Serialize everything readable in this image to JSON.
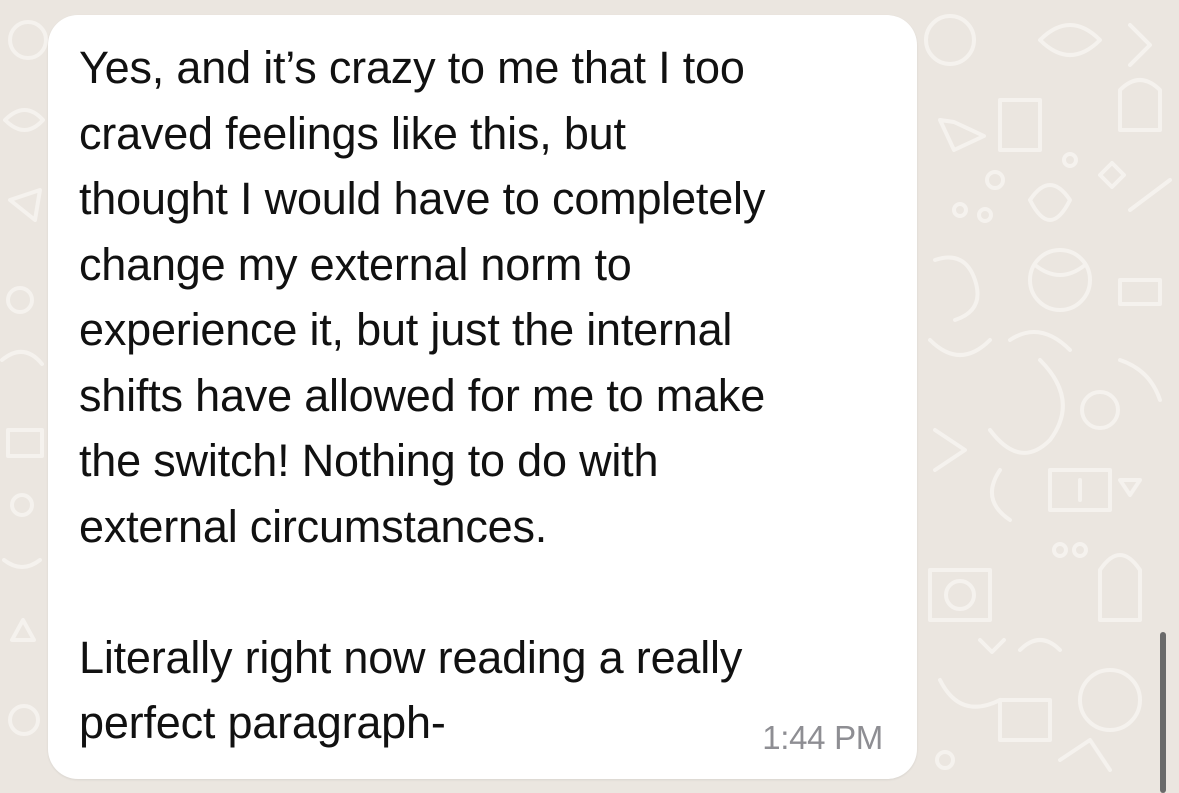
{
  "conversation": {
    "message": {
      "text": "Yes, and it’s crazy to me that I too\ncraved feelings like this, but\nthought I would have to completely\nchange my external norm to\nexperience it, but just the internal\nshifts have allowed for me to make\nthe switch! Nothing to do with\nexternal circumstances.\n\nLiterally right now reading a really\nperfect paragraph-",
      "time": "1:44 PM"
    }
  },
  "colors": {
    "wallpaper": "#ebe6e0",
    "bubble": "#ffffff",
    "text": "#111111",
    "timestamp": "#8e8e93"
  },
  "icons": [
    "chat-wallpaper-doodles",
    "scrollbar"
  ]
}
